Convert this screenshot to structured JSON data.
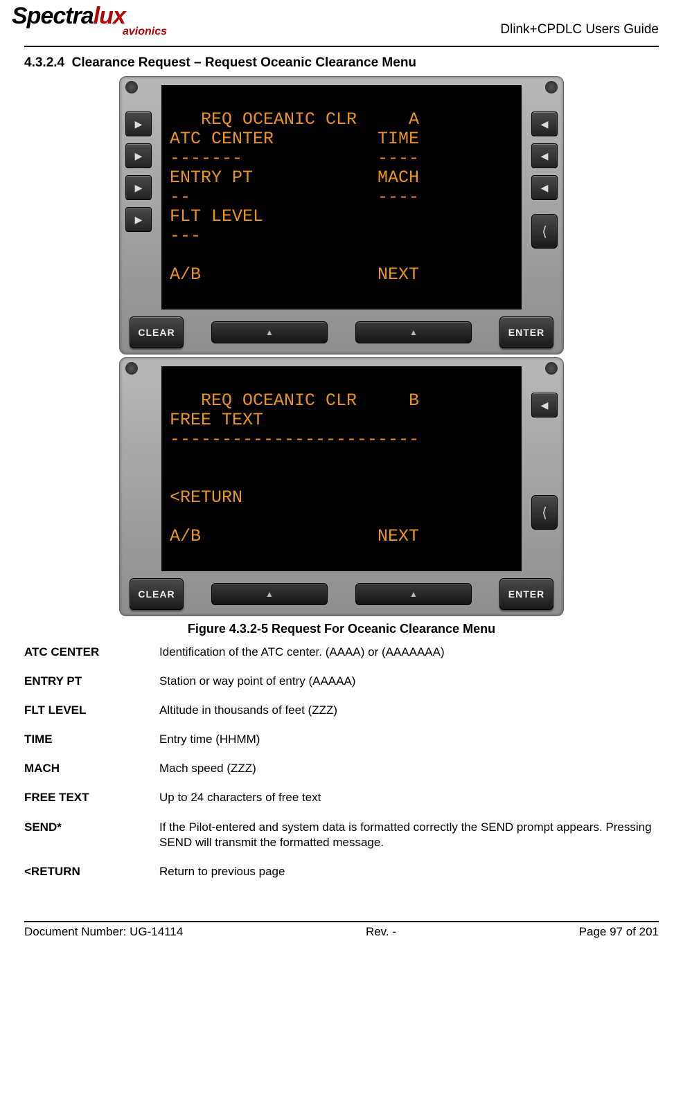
{
  "header": {
    "logo_a": "Spectra",
    "logo_b": "lux",
    "logo_sub": "avionics",
    "guide_title": "Dlink+CPDLC Users Guide"
  },
  "section": {
    "number": "4.3.2.4",
    "title": "Clearance Request – Request Oceanic Clearance Menu"
  },
  "screenA": {
    "line1": "   REQ OCEANIC CLR     A",
    "line2": "ATC CENTER          TIME",
    "line3": "-------             ----",
    "line4": "ENTRY PT            MACH",
    "line5": "--                  ----",
    "line6": "FLT LEVEL",
    "line7": "---",
    "line8": "",
    "line9": "A/B                 NEXT"
  },
  "screenB": {
    "line1": "   REQ OCEANIC CLR     B",
    "line2": "FREE TEXT",
    "line3": "------------------------",
    "line4": "",
    "line5": "",
    "line6": "<RETURN",
    "line7": "",
    "line8": "A/B                 NEXT"
  },
  "buttons": {
    "clear": "CLEAR",
    "enter": "ENTER",
    "rocker_glyph": "▲"
  },
  "figure_caption": "Figure 4.3.2-5 Request For Oceanic Clearance Menu",
  "definitions": [
    {
      "term": "ATC CENTER",
      "desc": "Identification of the ATC center. (AAAA) or (AAAAAAA)"
    },
    {
      "term": "ENTRY PT",
      "desc": "Station or way point of entry (AAAAA)"
    },
    {
      "term": "FLT LEVEL",
      "desc": "Altitude in thousands of feet (ZZZ)"
    },
    {
      "term": "TIME",
      "desc": "Entry time (HHMM)"
    },
    {
      "term": "MACH",
      "desc": "Mach speed (ZZZ)"
    },
    {
      "term": "FREE TEXT",
      "desc": "Up to 24 characters of free text"
    },
    {
      "term": "SEND*",
      "desc": "If the Pilot-entered and system data is formatted correctly the SEND prompt appears. Pressing SEND will transmit the formatted message."
    },
    {
      "term": "<RETURN",
      "desc": "Return to previous page"
    }
  ],
  "footer": {
    "doc": "Document Number:  UG-14114",
    "rev": "Rev. -",
    "page": "Page 97 of 201"
  }
}
